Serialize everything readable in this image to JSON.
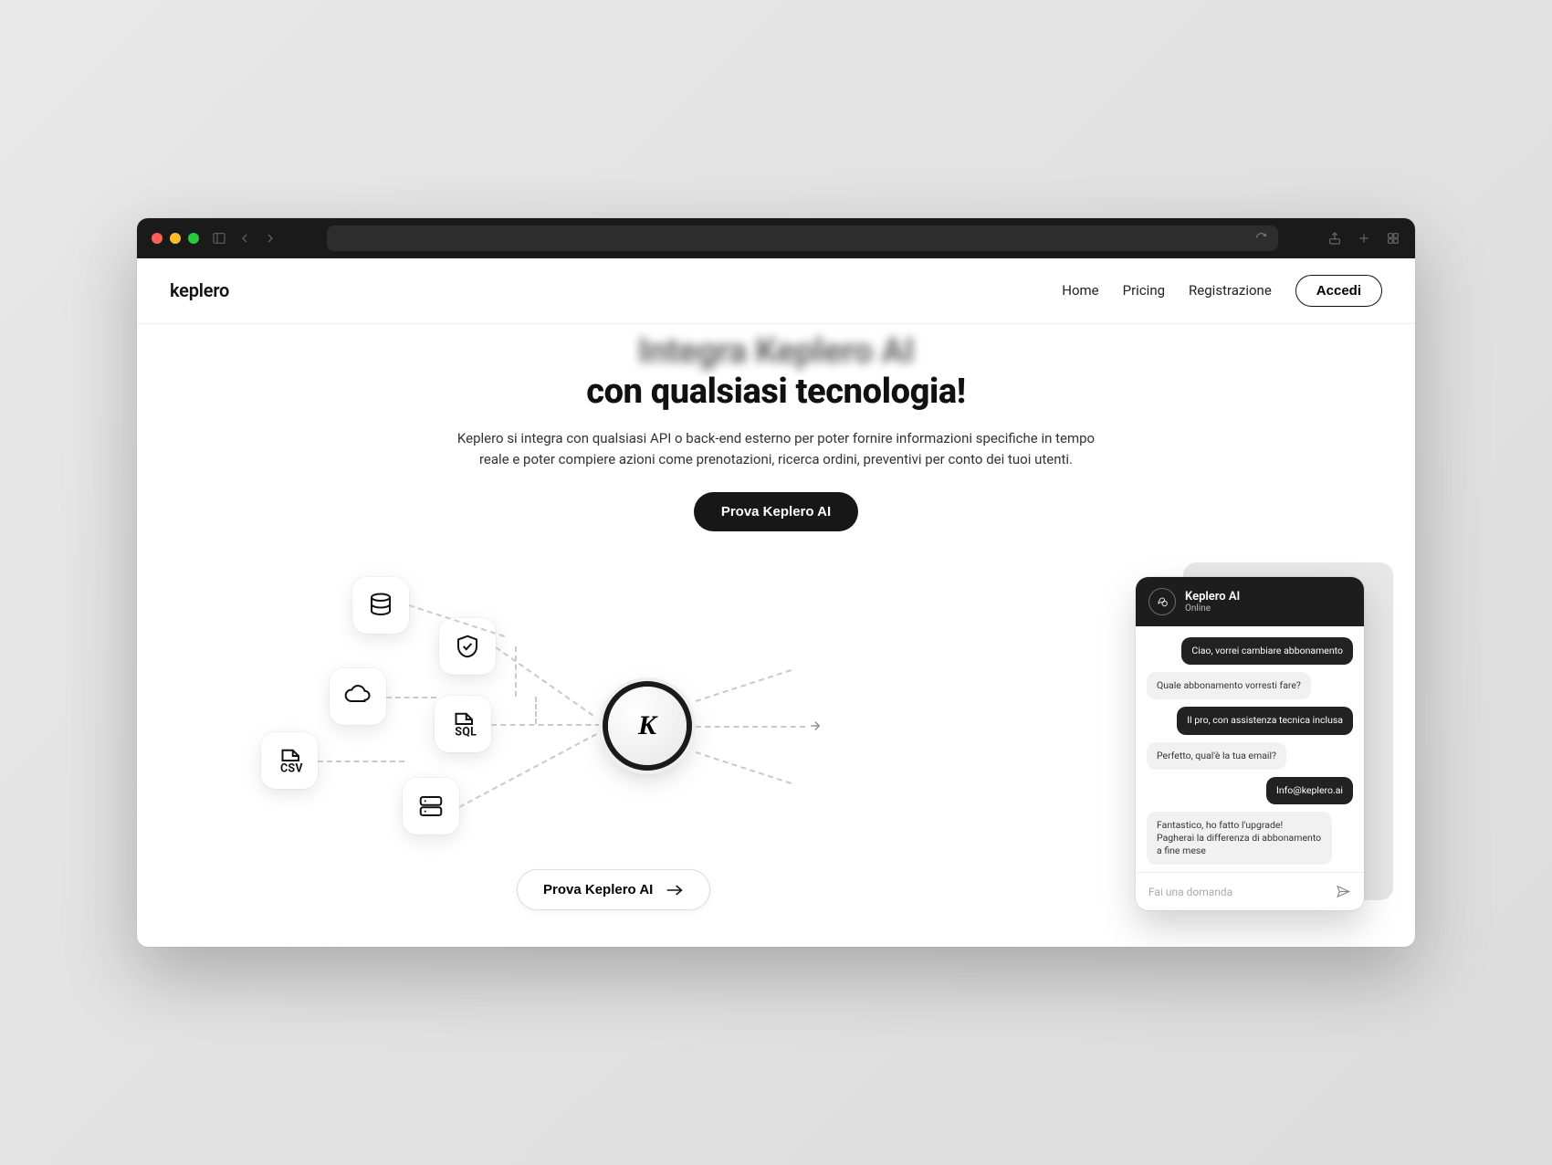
{
  "brand": "keplero",
  "nav": {
    "items": [
      "Home",
      "Pricing",
      "Registrazione"
    ],
    "login": "Accedi"
  },
  "hero": {
    "title_blurred": "Integra Keplero AI",
    "title_line2": "con qualsiasi tecnologia!",
    "description": "Keplero si integra con qualsiasi API o back-end esterno per poter fornire informazioni specifiche in tempo reale e poter compiere azioni come prenotazioni, ricerca ordini, preventivi per conto dei tuoi utenti.",
    "cta_primary": "Prova Keplero AI",
    "cta_secondary": "Prova Keplero AI"
  },
  "diagram": {
    "nodes": {
      "database": "database",
      "shield": "shield",
      "cloud": "cloud",
      "sql": "SQL",
      "csv": "CSV",
      "server": "server"
    },
    "center_glyph": "K"
  },
  "chat": {
    "title": "Keplero AI",
    "status": "Online",
    "messages": [
      {
        "from": "user",
        "text": "Ciao, vorrei cambiare abbonamento"
      },
      {
        "from": "bot",
        "text": "Quale abbonamento vorresti fare?"
      },
      {
        "from": "user",
        "text": "Il pro, con assistenza tecnica inclusa"
      },
      {
        "from": "bot",
        "text": "Perfetto, qual'è la tua email?"
      },
      {
        "from": "user",
        "text": "Info@keplero.ai"
      },
      {
        "from": "bot",
        "text": "Fantastico, ho fatto l'upgrade! Pagherai la differenza di abbonamento a fine mese"
      }
    ],
    "input_placeholder": "Fai una domanda"
  }
}
